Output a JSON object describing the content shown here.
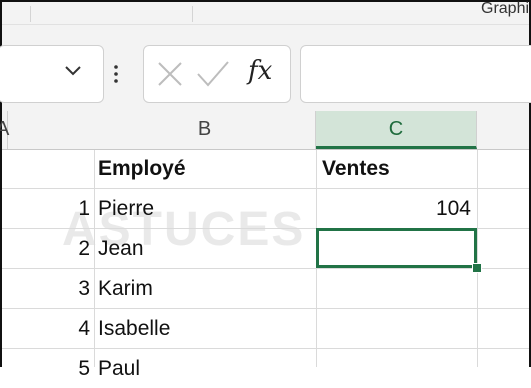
{
  "ribbon": {
    "partial_group_label": "Graphiques"
  },
  "formula_bar": {
    "name_box_value": "",
    "cancel_icon": "x-icon",
    "enter_icon": "checkmark-icon",
    "insert_function_label": "fx",
    "formula_value": ""
  },
  "columns": [
    {
      "label": "A",
      "selected": false
    },
    {
      "label": "B",
      "selected": false
    },
    {
      "label": "C",
      "selected": true
    }
  ],
  "rows": [
    {
      "col_a": "",
      "col_b": "Employé",
      "col_c": "Ventes",
      "header": true
    },
    {
      "col_a": "1",
      "col_b": "Pierre",
      "col_c": "104"
    },
    {
      "col_a": "2",
      "col_b": "Jean",
      "col_c": ""
    },
    {
      "col_a": "3",
      "col_b": "Karim",
      "col_c": ""
    },
    {
      "col_a": "4",
      "col_b": "Isabelle",
      "col_c": ""
    },
    {
      "col_a": "5",
      "col_b": "Paul",
      "col_c": ""
    }
  ],
  "watermark": "ASTUCES",
  "colors": {
    "accent": "#217346",
    "selected_header_bg": "#d3e4d8"
  }
}
